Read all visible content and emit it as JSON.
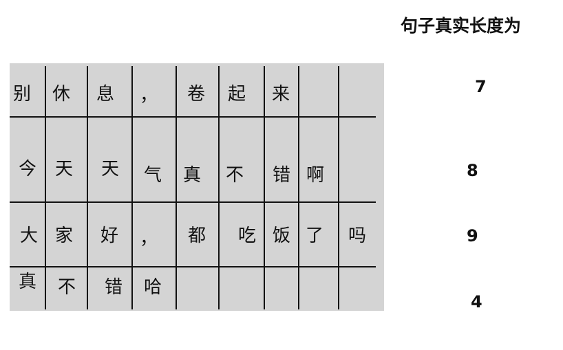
{
  "heading": "句子真实长度为",
  "rows": [
    {
      "chars": [
        "别",
        "休",
        "息",
        "，",
        "卷",
        "起",
        "来",
        "",
        ""
      ],
      "length": "7"
    },
    {
      "chars": [
        "今",
        "天",
        "天",
        "气",
        "真",
        "不",
        "错",
        "啊",
        ""
      ],
      "length": "8"
    },
    {
      "chars": [
        "大",
        "家",
        "好",
        "，",
        "都",
        "吃",
        "饭",
        "了",
        "吗"
      ],
      "length": "9"
    },
    {
      "chars": [
        "真",
        "不",
        "错",
        "哈",
        "",
        "",
        "",
        "",
        ""
      ],
      "length": "4"
    }
  ]
}
